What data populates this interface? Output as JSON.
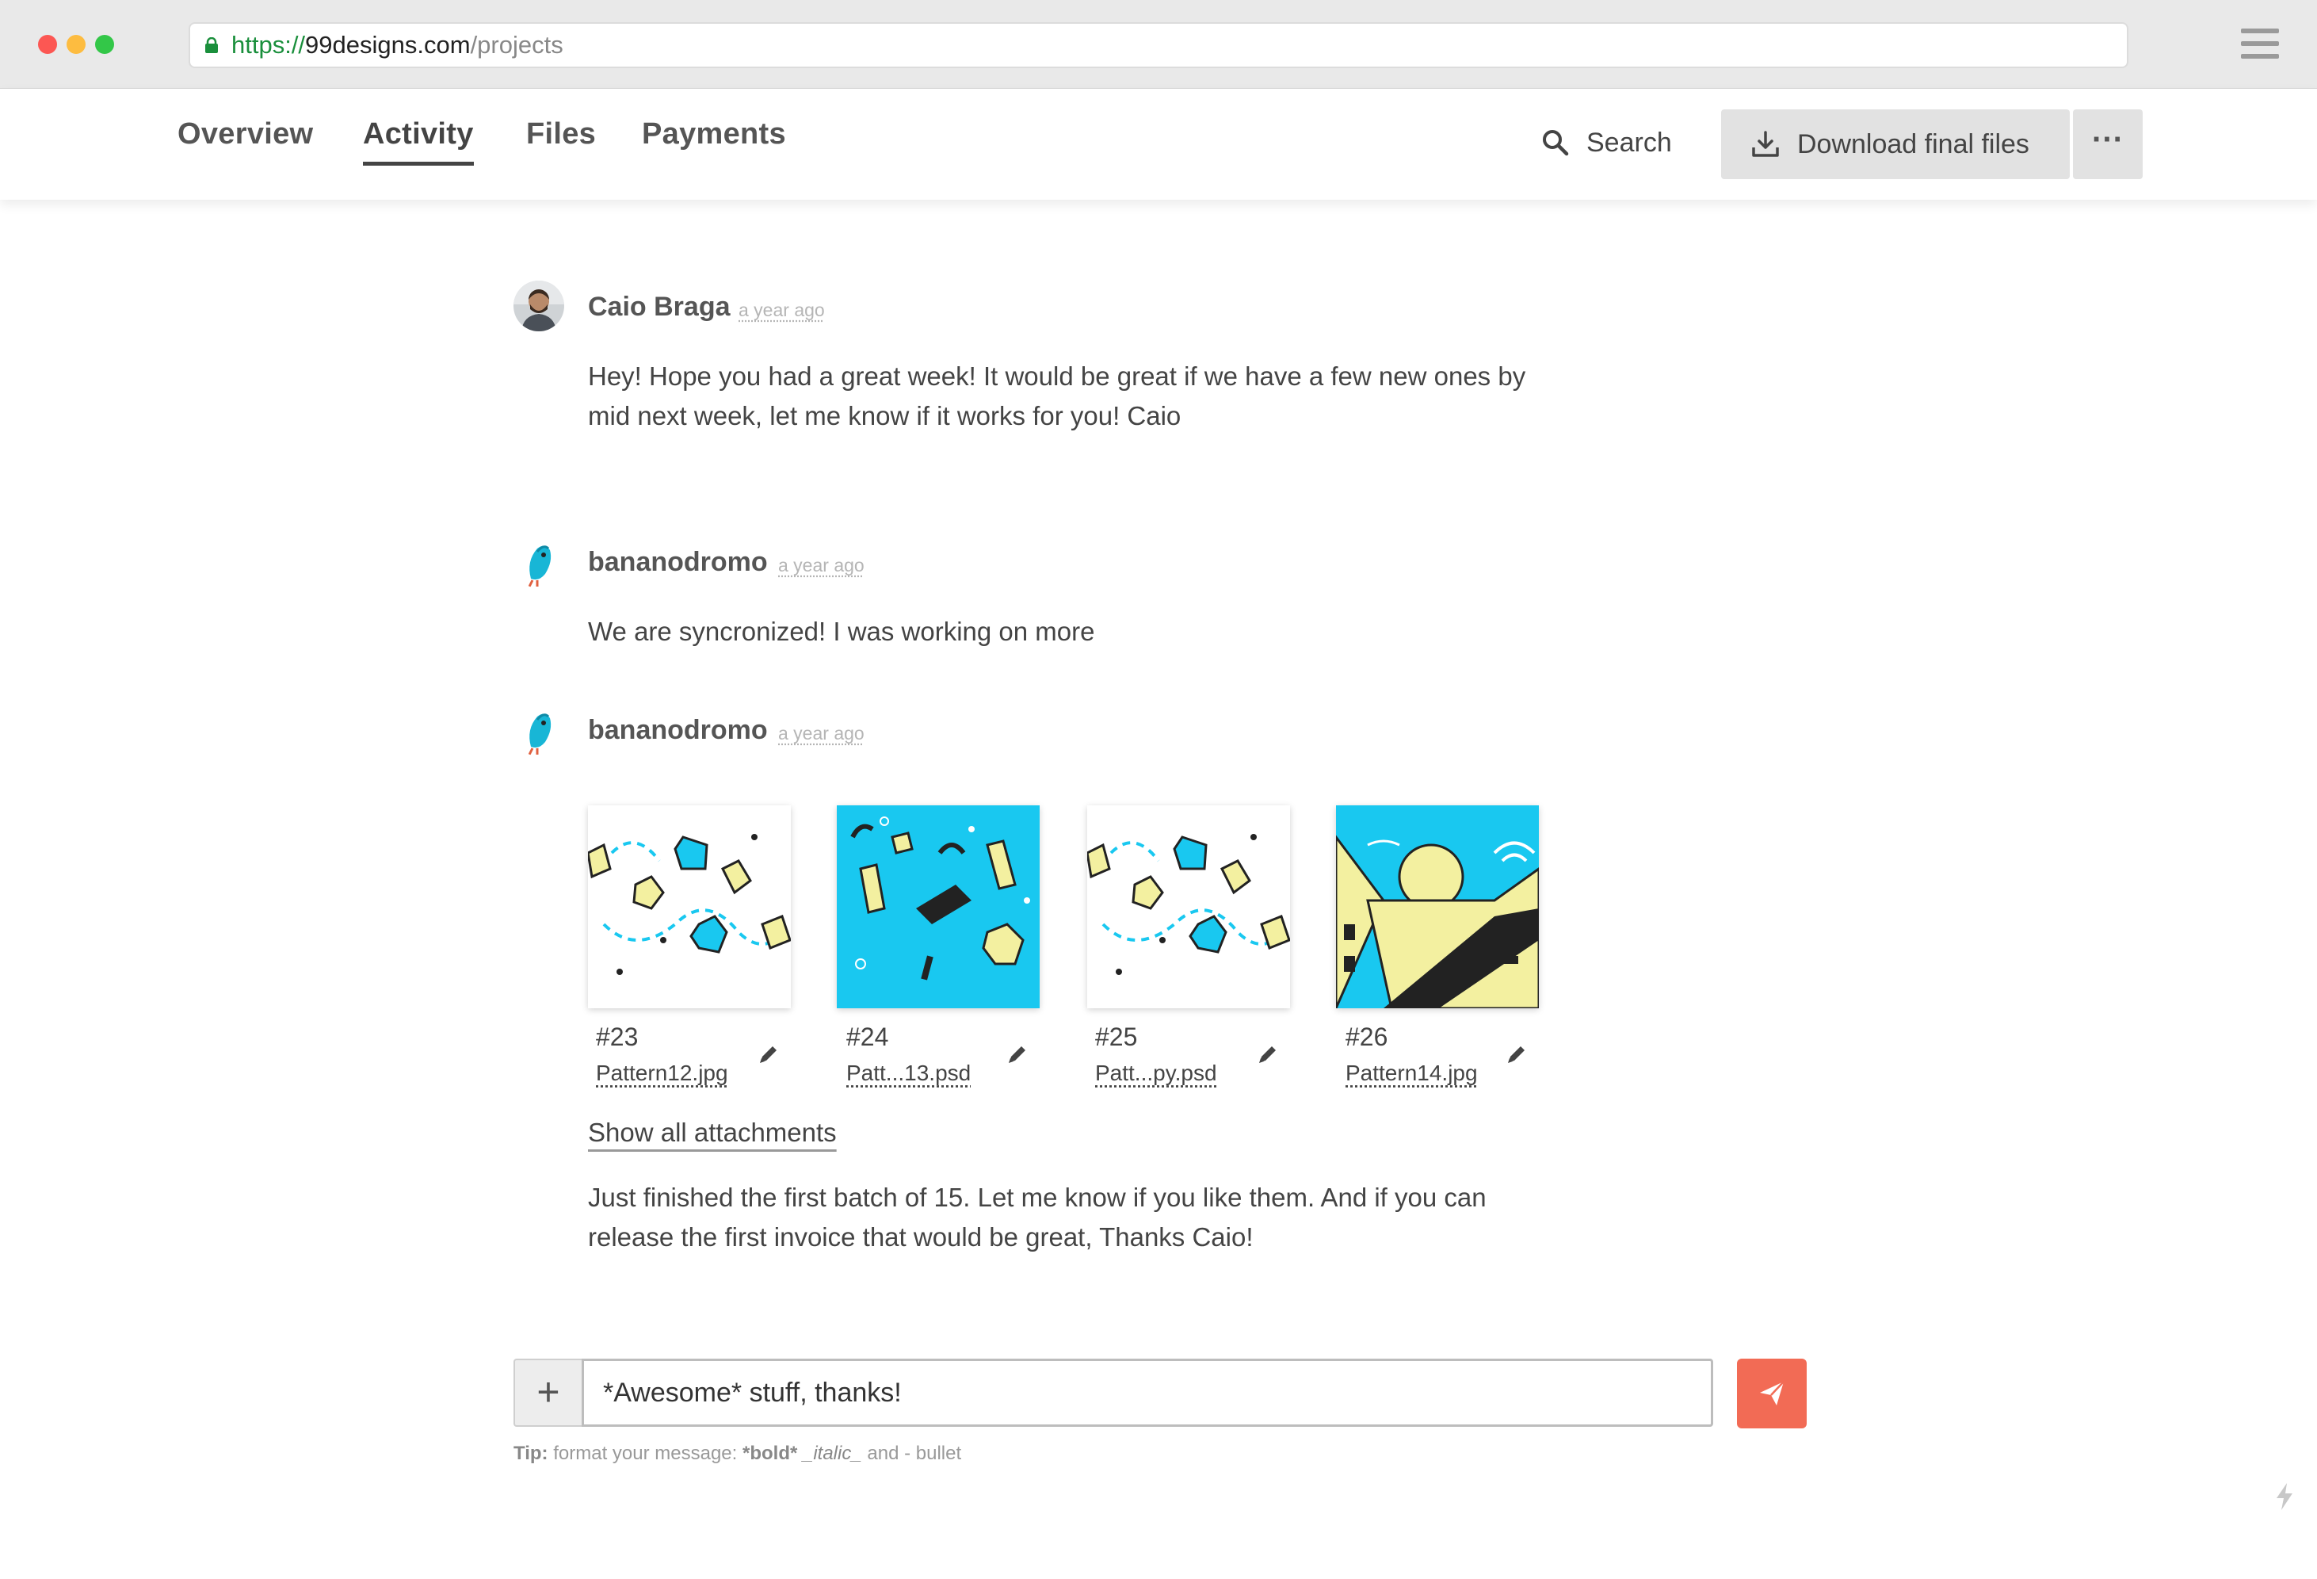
{
  "browser": {
    "url_scheme": "https://",
    "url_host": "99designs.com",
    "url_path": "/projects"
  },
  "nav": {
    "tabs": [
      {
        "label": "Overview",
        "active": false
      },
      {
        "label": "Activity",
        "active": true
      },
      {
        "label": "Files",
        "active": false
      },
      {
        "label": "Payments",
        "active": false
      }
    ],
    "search_label": "Search",
    "download_label": "Download final files",
    "more_label": "···"
  },
  "messages": [
    {
      "author": "Caio Braga",
      "time": "a year ago",
      "text": "Hey! Hope you had a great week! It would be great if we have a few new ones by mid next week, let me know if it works for you! Caio"
    },
    {
      "author": "bananodromo",
      "time": "a year ago",
      "text": "We are syncronized! I was working on more"
    },
    {
      "author": "bananodromo",
      "time": "a year ago",
      "text": "Just finished the first batch of 15. Let me know if you like them. And if you can release the first invoice that would be great, Thanks Caio!"
    }
  ],
  "attachments": [
    {
      "number": "#23",
      "filename": "Pattern12.jpg",
      "style": "white-pattern"
    },
    {
      "number": "#24",
      "filename": "Patt...13.psd",
      "style": "blue-pattern"
    },
    {
      "number": "#25",
      "filename": "Patt...py.psd",
      "style": "white-pattern"
    },
    {
      "number": "#26",
      "filename": "Pattern14.jpg",
      "style": "city-illustration"
    }
  ],
  "show_all_label": "Show all attachments",
  "composer": {
    "value": "*Awesome* stuff, thanks!",
    "plus_label": "+"
  },
  "tip": {
    "prefix": "Tip:",
    "text": " format your message: ",
    "bold": "*bold*",
    "italic": "_italic_",
    "rest": " and - bullet"
  },
  "colors": {
    "accent": "#f26b55",
    "thumb_blue": "#19c8f0",
    "secure_green": "#1a8f3c"
  },
  "icons": [
    "lock-icon",
    "hamburger-icon",
    "search-icon",
    "download-icon",
    "more-icon",
    "edit-icon",
    "plus-icon",
    "send-icon",
    "bolt-icon"
  ]
}
